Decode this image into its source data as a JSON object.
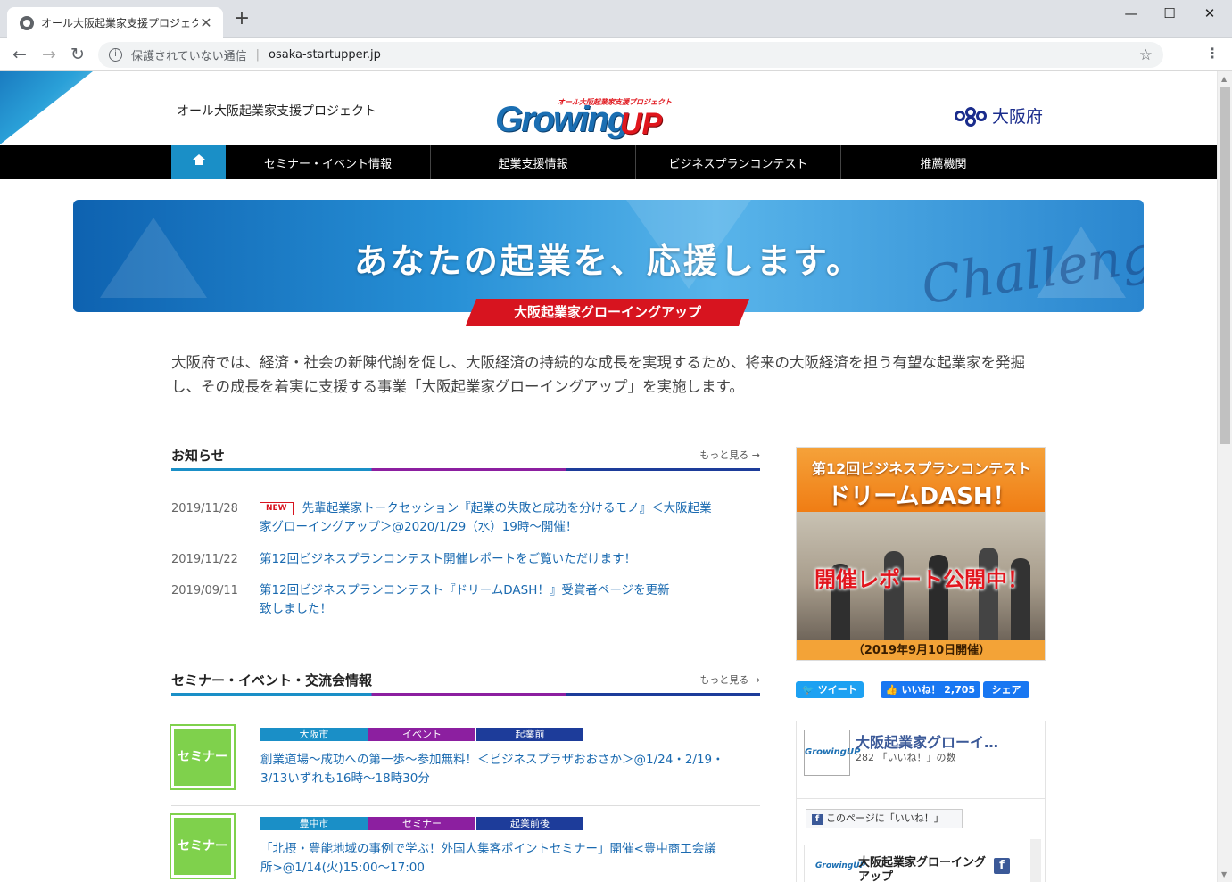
{
  "browser": {
    "tab_title": "オール大阪起業家支援プロジェクト",
    "tab_close": "✕",
    "new_tab": "+",
    "minimize": "—",
    "maximize": "☐",
    "close": "✕",
    "back": "←",
    "forward": "→",
    "reload": "↻",
    "info_glyph": "i",
    "security_status": "保護されていない通信",
    "separator": "|",
    "url": "osaka-startupper.jp",
    "star": "☆",
    "menu": "⋮"
  },
  "header": {
    "site_tagline": "オール大阪起業家支援プロジェクト",
    "logo_sub": "オール大阪起業家支援プロジェクト",
    "logo_main": "Growing",
    "logo_up": "UP",
    "prefecture": "大阪府"
  },
  "nav": {
    "items": [
      "セミナー・イベント情報",
      "起業支援情報",
      "ビジネスプランコンテスト",
      "推薦機関"
    ]
  },
  "hero": {
    "headline": "あなたの起業を、応援します。",
    "script": "Challenge",
    "ribbon": "大阪起業家グローイングアップ"
  },
  "intro": "大阪府では、経済・社会の新陳代謝を促し、大阪経済の持続的な成長を実現するため、将来の大阪経済を担う有望な起業家を発掘し、その成長を着実に支援する事業「大阪起業家グローイングアップ」を実施します。",
  "news": {
    "title": "お知らせ",
    "more": "もっと見る →",
    "new_badge": "NEW",
    "items": [
      {
        "date": "2019/11/28",
        "text": "先輩起業家トークセッション『起業の失敗と成功を分けるモノ』＜大阪起業家グローイングアップ＞@2020/1/29（水）19時～開催！"
      },
      {
        "date": "2019/11/22",
        "text": "第12回ビジネスプランコンテスト開催レポートをご覧いただけます！"
      },
      {
        "date": "2019/09/11",
        "text": "第12回ビジネスプランコンテスト『ドリームDASH！』受賞者ページを更新致しました！"
      }
    ]
  },
  "events": {
    "title": "セミナー・イベント・交流会情報",
    "more": "もっと見る →",
    "items": [
      {
        "thumb": "セミナー",
        "tags": [
          "大阪市",
          "イベント",
          "起業前"
        ],
        "title": "創業道場～成功への第一歩～参加無料！＜ビジネスプラザおおさか＞@1/24・2/19・3/13いずれも16時～18時30分"
      },
      {
        "thumb": "セミナー",
        "tags": [
          "豊中市",
          "セミナー",
          "起業前後"
        ],
        "title": "「北摂・豊能地域の事例で学ぶ！外国人集客ポイントセミナー」開催<豊中商工会議所>@1/14(火)15:00～17:00"
      }
    ]
  },
  "tag_colors": [
    "#1a8fc7",
    "#8c1fa0",
    "#1d3c9a"
  ],
  "banner": {
    "line1": "第12回ビジネスプランコンテスト",
    "line2": "ドリームDASH！",
    "report": "開催レポート公開中！",
    "date": "（2019年9月10日開催）"
  },
  "social": {
    "tweet": "ツイート",
    "like": "いいね！ 2,705",
    "share": "シェア"
  },
  "facebook": {
    "avatar_text": "GrowingUP",
    "page_name": "大阪起業家グローイ…",
    "likes_count": "282 「いいね！」の数",
    "like_button": "このページに「いいね！」",
    "f_glyph": "f",
    "post_logo": "GrowingUP",
    "post_name": "大阪起業家グローイングアップ"
  }
}
